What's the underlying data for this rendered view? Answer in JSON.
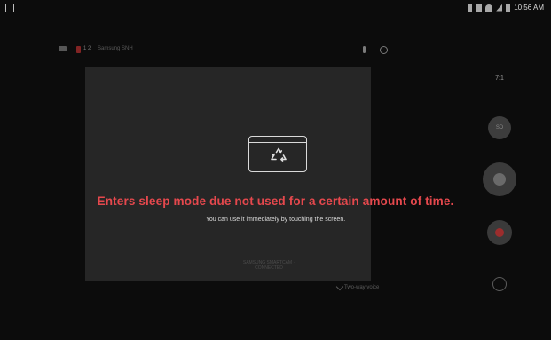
{
  "status_bar": {
    "time": "10:56 AM"
  },
  "camera_toolbar": {
    "count": "1 2",
    "camera_name": "Samsung SNH"
  },
  "sleep_overlay": {
    "title": "Enters sleep mode due not used for a certain amount of time.",
    "subtitle": "You can use it immediately by touching the screen.",
    "icon": "recycle-icon"
  },
  "camera_view": {
    "bottom_label": "SAMSUNG SMARTCAM · CONNECTED",
    "footer_label": "Two-way voice"
  },
  "controls": {
    "aspect_ratio": "7:1",
    "small_button": "SD"
  },
  "colors": {
    "alert_red": "#e5484d",
    "background": "#0c0c0c"
  }
}
